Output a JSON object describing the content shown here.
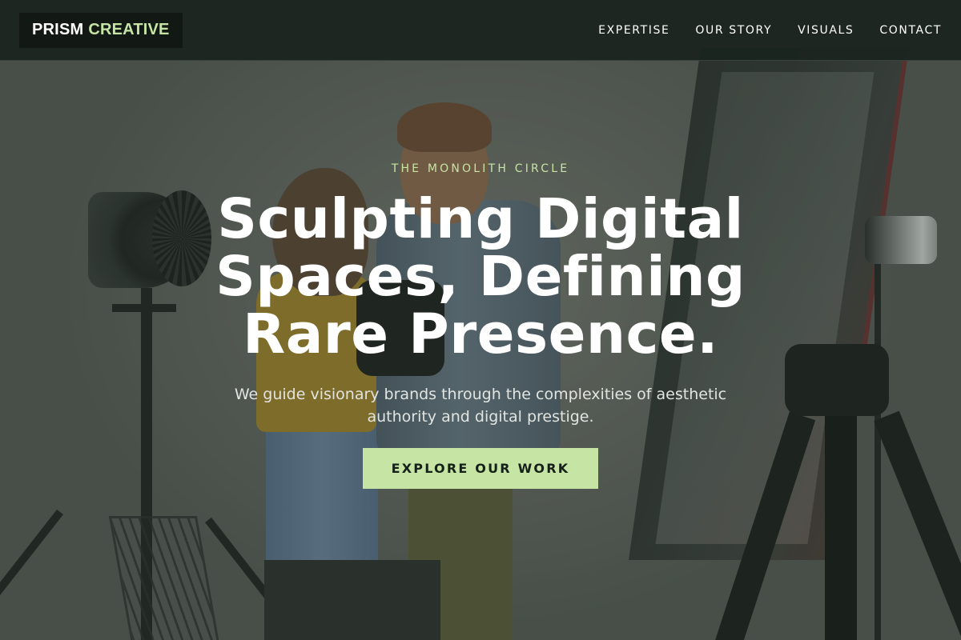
{
  "header": {
    "logo": {
      "primary": "PRISM",
      "accent": "CREATIVE"
    },
    "nav": [
      {
        "label": "EXPERTISE"
      },
      {
        "label": "OUR STORY"
      },
      {
        "label": "VISUALS"
      },
      {
        "label": "CONTACT"
      }
    ]
  },
  "hero": {
    "eyebrow": "THE MONOLITH CIRCLE",
    "headline": "Sculpting Digital Spaces, Defining Rare Presence.",
    "subhead": "We guide visionary brands through the complexities of aesthetic authority and digital prestige.",
    "cta_label": "EXPLORE OUR WORK"
  },
  "colors": {
    "accent": "#c6e4a4",
    "header_bg": "#1b241f",
    "cta_text": "#152018"
  }
}
